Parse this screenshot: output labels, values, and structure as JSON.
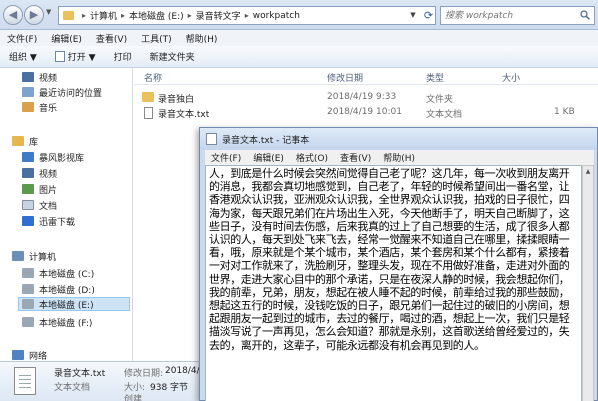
{
  "explorer": {
    "address": {
      "segments": [
        "计算机",
        "本地磁盘 (E:)",
        "录音转文字",
        "workpatch"
      ],
      "search_placeholder": "搜索 workpatch"
    },
    "menu": [
      "文件(F)",
      "编辑(E)",
      "查看(V)",
      "工具(T)",
      "帮助(H)"
    ],
    "toolbar": {
      "organize": "组织 ▼",
      "open": "打开 ▼",
      "print": "打印",
      "new_folder": "新建文件夹"
    },
    "nav": {
      "favorites": [
        "视频",
        "最近访问的位置",
        "音乐"
      ],
      "libraries_label": "库",
      "libraries": [
        "暴风影视库",
        "视频",
        "图片",
        "文档",
        "迅雷下载"
      ],
      "computer_label": "计算机",
      "drives": [
        "本地磁盘 (C:)",
        "本地磁盘 (D:)",
        "本地磁盘 (E:)",
        "本地磁盘 (F:)"
      ],
      "network_label": "网络"
    },
    "columns": {
      "name": "名称",
      "date": "修改日期",
      "type": "类型",
      "size": "大小"
    },
    "files": [
      {
        "name": "录音独白",
        "date": "2018/4/19 9:33",
        "type": "文件夹",
        "size": ""
      },
      {
        "name": "录音文本.txt",
        "date": "2018/4/19 10:01",
        "type": "文本文档",
        "size": "1 KB"
      }
    ],
    "details": {
      "name": "录音文本.txt",
      "type": "文本文档",
      "modified_label": "修改日期:",
      "modified_value": "2018/4/19 10",
      "size_label": "大小:",
      "size_value": "938 字节",
      "created_label": "创建"
    }
  },
  "notepad": {
    "title": "录音文本.txt - 记事本",
    "menu": [
      "文件(F)",
      "编辑(E)",
      "格式(O)",
      "查看(V)",
      "帮助(H)"
    ],
    "text": "人，到底是什么时候会突然间觉得自己老了呢？这几年，每一次收到朋友离开的消息，我都会真切地感觉到，自己老了，年轻的时候希望间出一番名堂，让香港观众认识我，亚洲观众认识我，全世界观众认识我，拍戏的日子很忙，四海为家，每天跟兄弟们在片场出生入死，今天他断手了，明天自己断脚了，这些日子，没有时间去伤感，后来我真的过上了自己想要的生活，成了很多人都认识的人，每天到处飞来飞去，经常一觉醒来不知道自己在哪里，揉揉眼睛一看，哦，原来就是个某个城市，某个酒店，某个套房和某个什么都有，紧接着一对对工作就来了，洗脸刷牙，整理头发，现在不用做好准备，走进对外面的世界，走进大家心目中的那个承诺，只是在夜深人静的时候，我会想起你们，我的前辈，兄弟，朋友，想起在被人睡不起的时候，前辈给过我的那些鼓励，想起这五行的时候，没钱吃饭的日子，跟兄弟们一起住过的破旧的小房间，想起跟朋友一起到过的城市，去过的餐厅，喝过的酒，想起上一次，我们只是轻描淡写说了一声再见，怎么会知道？那就是永别，这首歌送给曾经爱过的，失去的，离开的，这辈子，可能永远都没有机会再见到的人。"
  }
}
